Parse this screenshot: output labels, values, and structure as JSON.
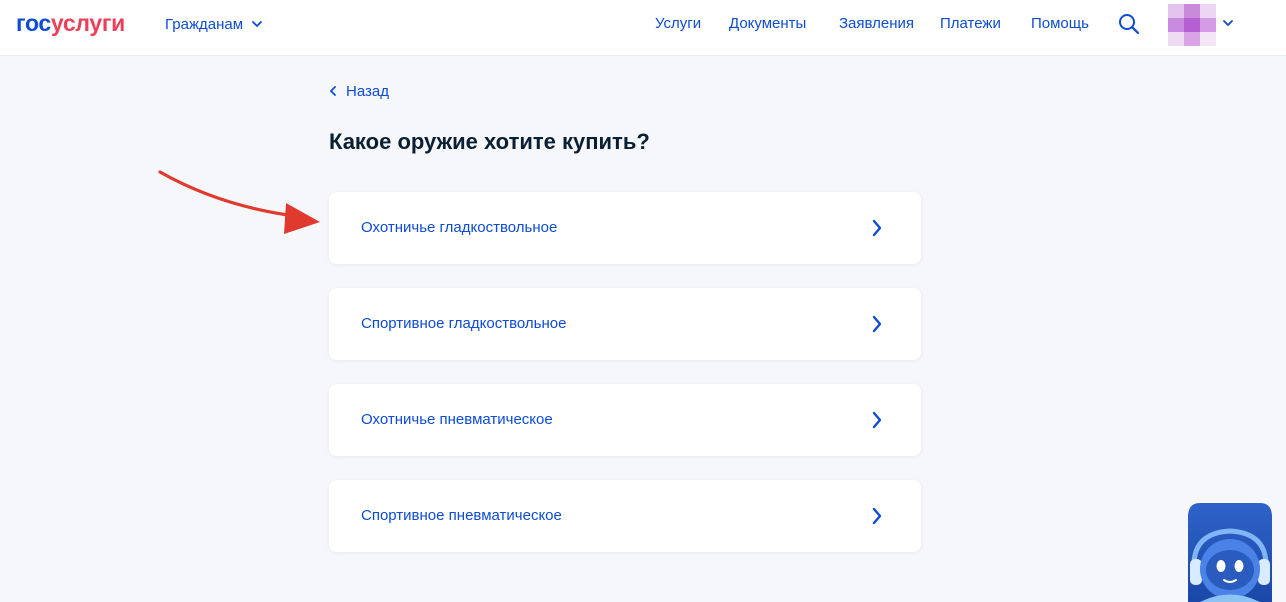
{
  "header": {
    "logo": {
      "part1": "гос",
      "part2": "услуги"
    },
    "citizens_menu": "Гражданам",
    "nav": [
      "Услуги",
      "Документы",
      "Заявления",
      "Платежи",
      "Помощь"
    ],
    "icons": {
      "search": "search-icon",
      "avatar": "user-avatar",
      "caret": "chevron-down-icon"
    }
  },
  "main": {
    "back_label": "Назад",
    "title": "Какое оружие хотите купить?",
    "options": [
      {
        "label": "Охотничье гладкоствольное"
      },
      {
        "label": "Спортивное гладкоствольное"
      },
      {
        "label": "Охотничье пневматическое"
      },
      {
        "label": "Спортивное пневматическое"
      }
    ]
  },
  "colors": {
    "brand_blue": "#0d4cd3",
    "brand_red": "#ee3f58",
    "text_dark": "#0b1f33",
    "page_bg": "#f5f7fb",
    "annotation_arrow": "#e03a2f"
  },
  "widgets": {
    "assistant": "robot-assistant-icon"
  }
}
